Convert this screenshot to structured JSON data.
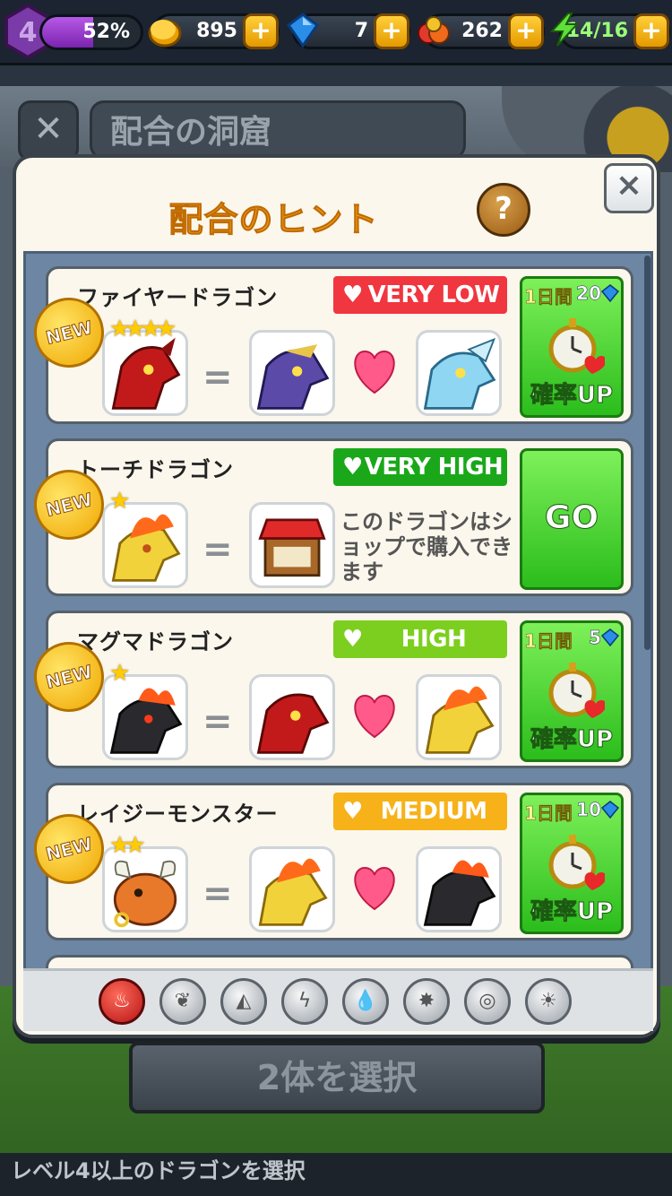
{
  "topbar": {
    "level": "4",
    "xp_percent": "52%",
    "xp_fill": 0.52,
    "gold": "895",
    "gems": "7",
    "food": "262",
    "energy": "14/16"
  },
  "background": {
    "cave_title": "配合の洞窟",
    "select_button": "2体を選択",
    "bottom_hint": "レベル4以上のドラゴンを選択"
  },
  "dialog": {
    "title": "配合のヒント",
    "help": "?",
    "close": "×",
    "cards": [
      {
        "name": "ファイヤードラゴン",
        "badge": "NEW",
        "stars": "★★★★",
        "rate": "VERY LOW",
        "rate_color": "#f0363f",
        "boost_days": "1日間",
        "boost_cost": "20",
        "boost_label": "確率UP"
      },
      {
        "name": "トーチドラゴン",
        "badge": "NEW",
        "stars": "★",
        "rate": "VERY HIGH",
        "rate_color": "#1aa81a",
        "shop_note": "このドラゴンはショップで購入できます",
        "go_label": "GO"
      },
      {
        "name": "マグマドラゴン",
        "badge": "NEW",
        "stars": "★",
        "rate": "HIGH",
        "rate_color": "#7ccf1e",
        "boost_days": "1日間",
        "boost_cost": "5",
        "boost_label": "確率UP"
      },
      {
        "name": "レイジーモンスター",
        "badge": "NEW",
        "stars": "★★",
        "rate": "MEDIUM",
        "rate_color": "#f7b21a",
        "boost_days": "1日間",
        "boost_cost": "10",
        "boost_label": "確率UP"
      }
    ],
    "filters": [
      "fire-icon",
      "plant-icon",
      "earth-icon",
      "lightning-icon",
      "water-icon",
      "metal-icon",
      "wind-icon",
      "light-icon"
    ]
  }
}
